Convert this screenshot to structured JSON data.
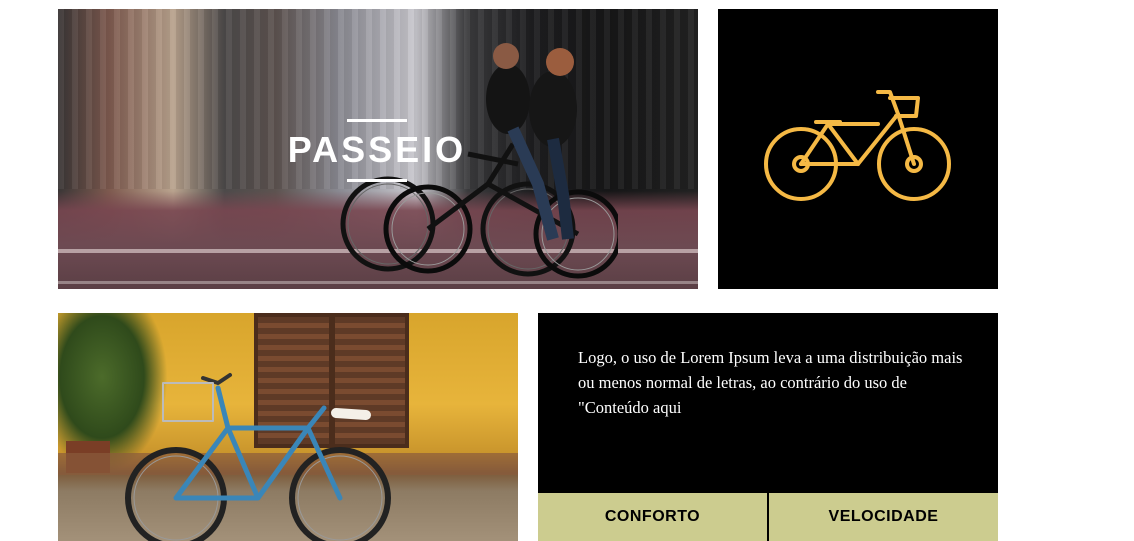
{
  "hero": {
    "title": "PASSEIO",
    "image": "photo of two women riding bicycles on a city street"
  },
  "icon_tile": {
    "icon": "bicycle-icon",
    "icon_color": "#f5b945",
    "background": "#000000"
  },
  "bike_photo": {
    "image": "photo of a blue bicycle with basket parked against a yellow wall"
  },
  "card": {
    "text": "Logo, o uso de Lorem Ipsum leva a uma distribuição mais ou menos normal de letras, ao contrário do uso de \"Conteúdo aqui",
    "buttons": [
      {
        "label": "CONFORTO"
      },
      {
        "label": "VELOCIDADE"
      }
    ],
    "button_bg": "#cccc8f"
  }
}
